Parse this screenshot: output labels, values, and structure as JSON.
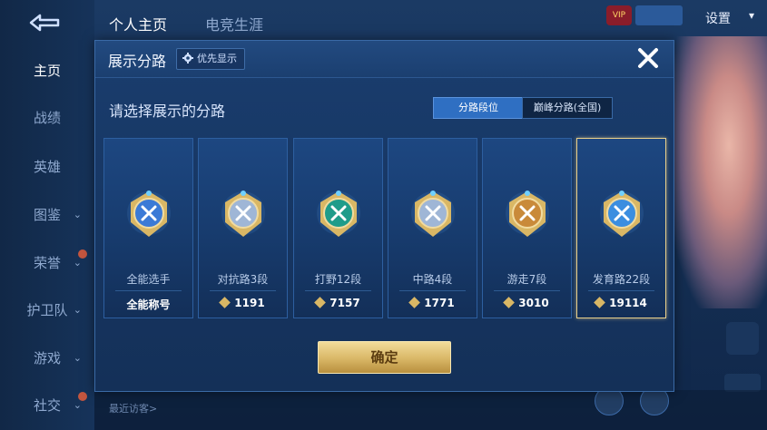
{
  "app": {
    "sidebar": {
      "items": [
        {
          "label": "主页",
          "active": true
        },
        {
          "label": "战绩"
        },
        {
          "label": "英雄"
        },
        {
          "label": "图鉴"
        },
        {
          "label": "荣誉"
        },
        {
          "label": "护卫队"
        },
        {
          "label": "游戏"
        },
        {
          "label": "社交"
        }
      ]
    },
    "top_tabs": [
      {
        "label": "个人主页",
        "active": true
      },
      {
        "label": "电竞生涯"
      }
    ],
    "settings_label": "设置",
    "vip_text": "VIP",
    "visitors_label": "最近访客>"
  },
  "modal": {
    "title": "展示分路",
    "priority_label": "优先显示",
    "prompt": "请选择展示的分路",
    "segments": [
      {
        "label": "分路段位",
        "active": true
      },
      {
        "label": "巅峰分路(全国)",
        "active": false
      }
    ],
    "cards": [
      {
        "label": "全能选手",
        "value": "全能称号",
        "has_points_icon": false,
        "selected": false,
        "badge": "all-rounder-badge-icon",
        "color": "#3b7ad6"
      },
      {
        "label": "对抗路3段",
        "value": "1191",
        "has_points_icon": true,
        "selected": false,
        "badge": "clash-lane-badge-icon",
        "color": "#9fb6d6"
      },
      {
        "label": "打野12段",
        "value": "7157",
        "has_points_icon": true,
        "selected": false,
        "badge": "jungle-badge-icon",
        "color": "#1f9c8a"
      },
      {
        "label": "中路4段",
        "value": "1771",
        "has_points_icon": true,
        "selected": false,
        "badge": "mid-lane-badge-icon",
        "color": "#9fb6d6"
      },
      {
        "label": "游走7段",
        "value": "3010",
        "has_points_icon": true,
        "selected": false,
        "badge": "roam-badge-icon",
        "color": "#c98a3a"
      },
      {
        "label": "发育路22段",
        "value": "19114",
        "has_points_icon": true,
        "selected": true,
        "badge": "farm-lane-badge-icon",
        "color": "#3b8ee0"
      }
    ],
    "confirm_label": "确定"
  },
  "colors": {
    "gold": "#d9b765",
    "accent_blue": "#2f6fc2"
  }
}
